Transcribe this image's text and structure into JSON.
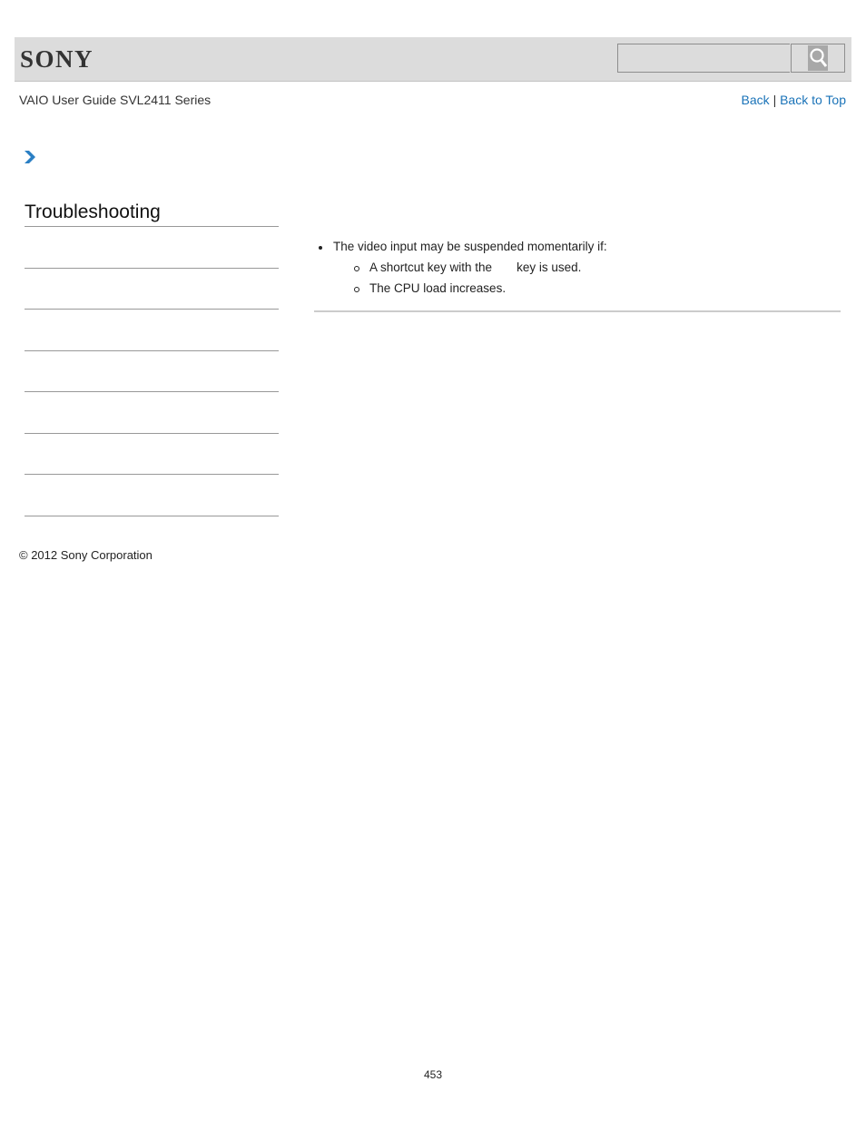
{
  "header": {
    "logo": "SONY",
    "search": {
      "placeholder": "",
      "value": "",
      "button_icon": "search-icon"
    }
  },
  "subheader": {
    "title": "VAIO User Guide SVL2411 Series",
    "links": {
      "back": "Back",
      "separator": "|",
      "back_to_top": "Back to Top"
    }
  },
  "breadcrumb": {
    "icon": "chevron-right-icon"
  },
  "sidebar": {
    "title": "Troubleshooting",
    "items": [
      "",
      "",
      "",
      "",
      "",
      "",
      ""
    ]
  },
  "main": {
    "bullets": [
      {
        "text": "The video input may be suspended momentarily if:",
        "sub": [
          {
            "before": "A shortcut key with the",
            "after": "key is used."
          },
          {
            "text": "The CPU load increases."
          }
        ]
      }
    ]
  },
  "footer": {
    "copyright": "© 2012 Sony Corporation",
    "page_number": "453"
  },
  "colors": {
    "link": "#1a73b8",
    "header_bg": "#dcdcdc",
    "chevron": "#2a7fc4"
  }
}
